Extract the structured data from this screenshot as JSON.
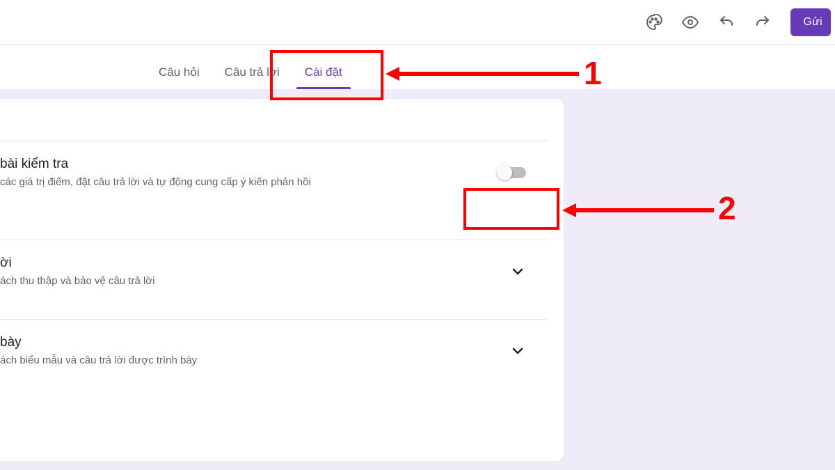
{
  "toolbar": {
    "send_label": "Gửi"
  },
  "tabs": {
    "questions": "Câu hỏi",
    "responses": "Câu trả lời",
    "settings": "Cài đặt"
  },
  "sections": {
    "quiz": {
      "title": "bài kiểm tra",
      "desc": "các giá trị điểm, đặt câu trả lời và tự động cung cấp ý kiến phản hồi"
    },
    "responses": {
      "title": "ời",
      "desc": "ách thu thập và bảo vệ câu trả lời"
    },
    "presentation": {
      "title": "bày",
      "desc": "ách biểu mẫu và câu trả lời được trình bày"
    }
  },
  "annotations": {
    "one": "1",
    "two": "2"
  }
}
